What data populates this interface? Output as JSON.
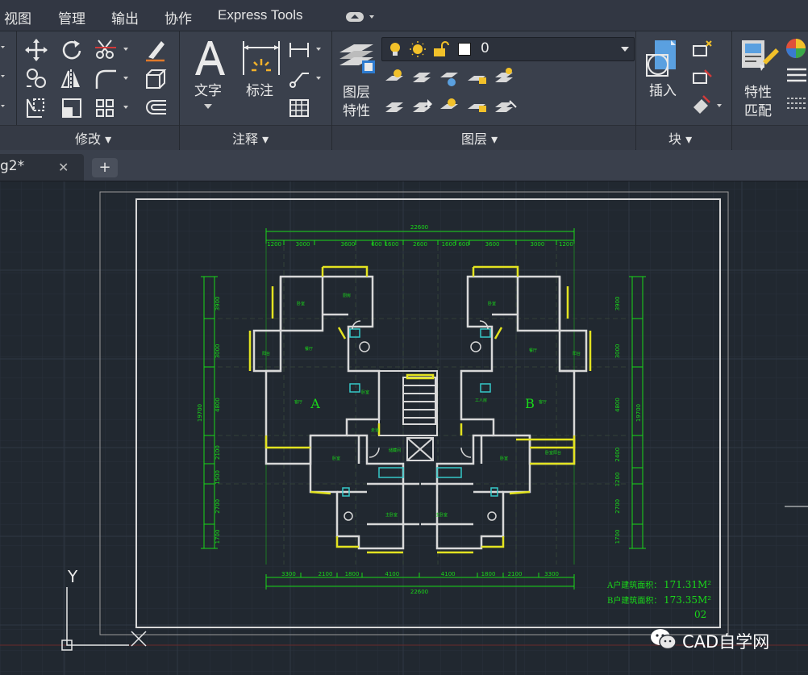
{
  "menubar": {
    "items": [
      "视图",
      "管理",
      "输出",
      "协作",
      "Express Tools"
    ]
  },
  "ribbon": {
    "modify_panel": {
      "title": "修改"
    },
    "annotation_panel": {
      "title": "注释",
      "text_label": "文字",
      "dimension_label": "标注"
    },
    "layers_panel": {
      "title": "图层",
      "properties_label": "图层\n特性",
      "current_layer": "0"
    },
    "block_panel": {
      "title": "块",
      "insert_label": "插入"
    },
    "properties_panel": {
      "match_label": "特性\n匹配"
    }
  },
  "tabs": {
    "document": "g2*",
    "close": "✕",
    "new": "+"
  },
  "drawing": {
    "overall_width_top": "22600",
    "top_dims": [
      "1200",
      "3000",
      "3600",
      "600",
      "1600",
      "2600",
      "1600",
      "600",
      "3600",
      "3000",
      "1200"
    ],
    "bottom_dims": [
      "3300",
      "2100",
      "1800",
      "4100",
      "4100",
      "1800",
      "2100",
      "3300"
    ],
    "overall_width_bottom": "22600",
    "left_dims": [
      "3900",
      "3000",
      "4800",
      "2100",
      "1500",
      "2700",
      "1700"
    ],
    "right_dims": [
      "3900",
      "3000",
      "4800",
      "2400",
      "1200",
      "2700",
      "1700"
    ],
    "overall_height": "19700",
    "unit_a": "A",
    "unit_b": "B",
    "area_a_label": "A户建筑面积：",
    "area_a_value": "171.31M²",
    "area_b_label": "B户建筑面积：",
    "area_b_value": "173.35M²",
    "sheet_no": "02",
    "ucs_y": "Y"
  },
  "watermark": {
    "text": "CAD自学网"
  },
  "colors": {
    "wall": "#d8d8d8",
    "window": "#e3e320",
    "dimension": "#19d819",
    "frame": "#cfcfcf",
    "grid": "#2a323c"
  }
}
